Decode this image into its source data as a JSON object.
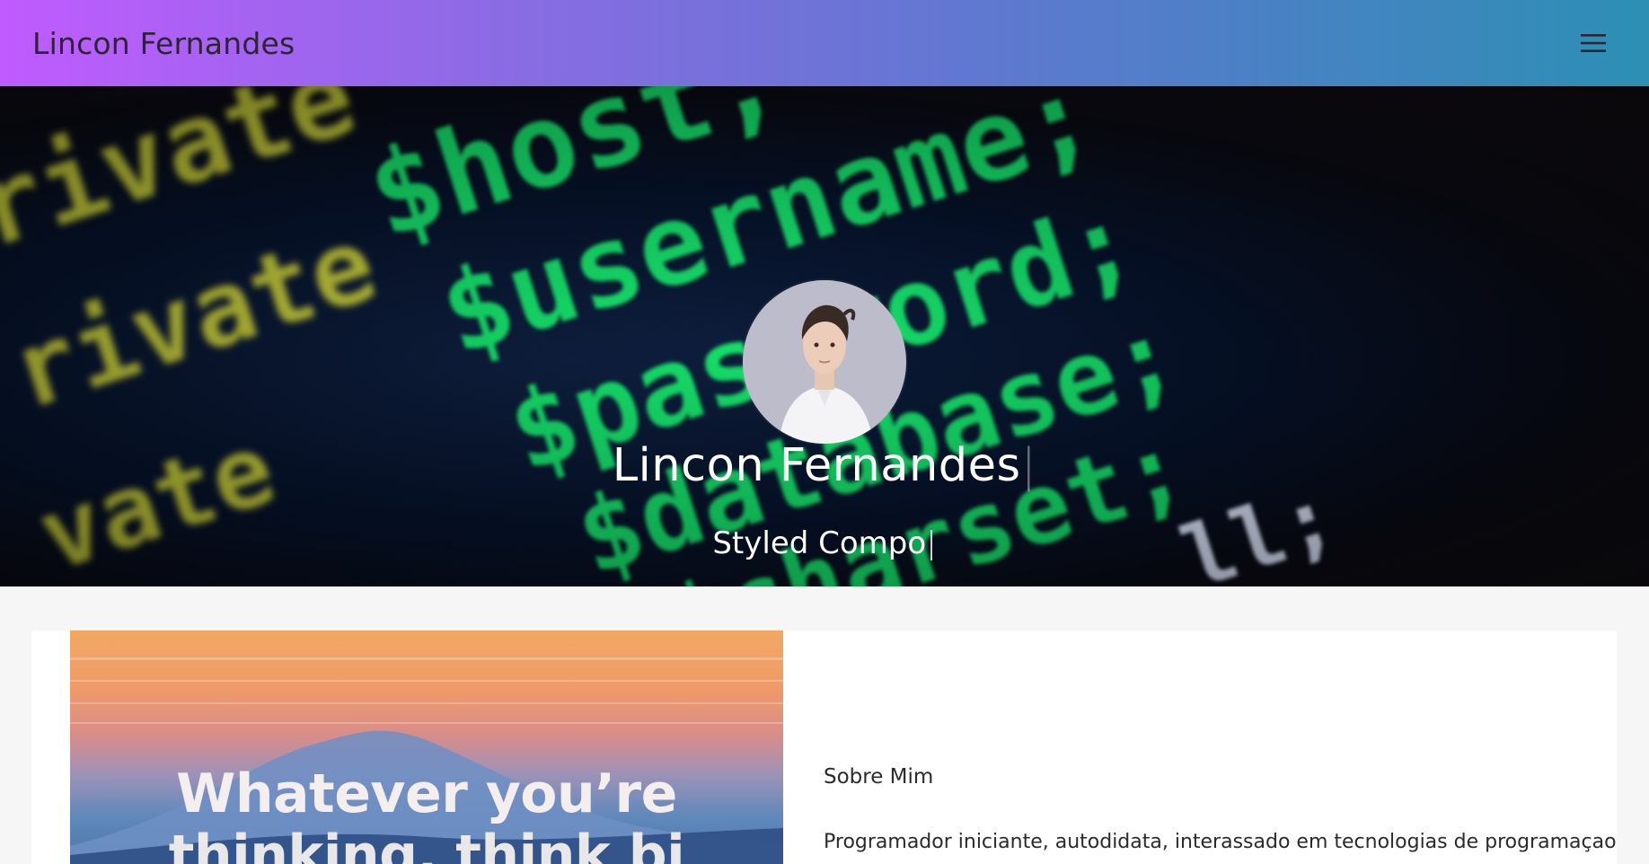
{
  "appbar": {
    "title": "Lincon Fernandes",
    "menu_icon": "hamburger-menu-icon",
    "gradient": [
      "#c05bff",
      "#2c8fb4"
    ]
  },
  "hero": {
    "name": "Lincon Fernandes",
    "typed_subtitle": "Styled Compo",
    "caret": "|",
    "background_icon": "code-screen-image",
    "avatar_icon": "profile-photo"
  },
  "promo": {
    "line1": "Whatever you’re",
    "line2": "thinking, think bi"
  },
  "about": {
    "title": "Sobre Mim",
    "text": "Programador iniciante, autodidata, interassado em tecnologias de programaçao"
  }
}
